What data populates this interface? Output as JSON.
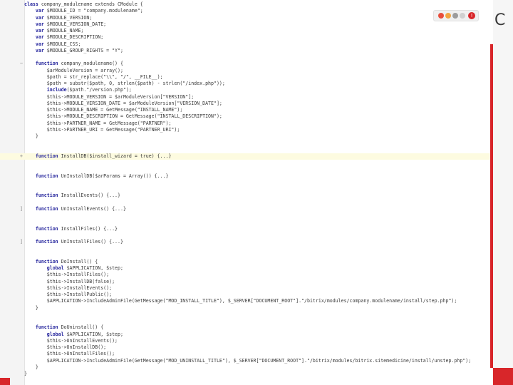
{
  "editor": {
    "lines": [
      {
        "fold": "",
        "text": "class company_modulename extends CModule {",
        "hl": false
      },
      {
        "fold": "",
        "text": "    var $MODULE_ID = \"company.modulename\";",
        "hl": false
      },
      {
        "fold": "",
        "text": "    var $MODULE_VERSION;",
        "hl": false
      },
      {
        "fold": "",
        "text": "    var $MODULE_VERSION_DATE;",
        "hl": false
      },
      {
        "fold": "",
        "text": "    var $MODULE_NAME;",
        "hl": false
      },
      {
        "fold": "",
        "text": "    var $MODULE_DESCRIPTION;",
        "hl": false
      },
      {
        "fold": "",
        "text": "    var $MODULE_CSS;",
        "hl": false
      },
      {
        "fold": "",
        "text": "    var $MODULE_GROUP_RIGHTS = \"Y\";",
        "hl": false
      },
      {
        "fold": "",
        "text": "",
        "hl": false
      },
      {
        "fold": "−",
        "text": "    function company_modulename() {",
        "hl": false
      },
      {
        "fold": "",
        "text": "        $arModuleVersion = array();",
        "hl": false
      },
      {
        "fold": "",
        "text": "        $path = str_replace(\"\\\\\", \"/\", __FILE__);",
        "hl": false
      },
      {
        "fold": "",
        "text": "        $path = substr($path, 0, strlen($path) - strlen(\"/index.php\"));",
        "hl": false
      },
      {
        "fold": "",
        "text": "        include($path.\"/version.php\");",
        "hl": false
      },
      {
        "fold": "",
        "text": "        $this->MODULE_VERSION = $arModuleVersion[\"VERSION\"];",
        "hl": false
      },
      {
        "fold": "",
        "text": "        $this->MODULE_VERSION_DATE = $arModuleVersion[\"VERSION_DATE\"];",
        "hl": false
      },
      {
        "fold": "",
        "text": "        $this->MODULE_NAME = GetMessage(\"INSTALL_NAME\");",
        "hl": false
      },
      {
        "fold": "",
        "text": "        $this->MODULE_DESCRIPTION = GetMessage(\"INSTALL_DESCRIPTION\");",
        "hl": false
      },
      {
        "fold": "",
        "text": "        $this->PARTNER_NAME = GetMessage(\"PARTNER\");",
        "hl": false
      },
      {
        "fold": "",
        "text": "        $this->PARTNER_URI = GetMessage(\"PARTNER_URI\");",
        "hl": false
      },
      {
        "fold": "",
        "text": "    }",
        "hl": false
      },
      {
        "fold": "",
        "text": "",
        "hl": false
      },
      {
        "fold": "",
        "text": "",
        "hl": false
      },
      {
        "fold": "+",
        "text": "    function InstallDB($install_wizard = true) {...}",
        "hl": true
      },
      {
        "fold": "",
        "text": "",
        "hl": false
      },
      {
        "fold": "",
        "text": "",
        "hl": false
      },
      {
        "fold": "",
        "text": "    function UnInstallDB($arParams = Array()) {...}",
        "hl": false
      },
      {
        "fold": "",
        "text": "",
        "hl": false
      },
      {
        "fold": "",
        "text": "",
        "hl": false
      },
      {
        "fold": "",
        "text": "    function InstallEvents() {...}",
        "hl": false
      },
      {
        "fold": "",
        "text": "",
        "hl": false
      },
      {
        "fold": "]",
        "text": "    function UnInstallEvents() {...}",
        "hl": false
      },
      {
        "fold": "",
        "text": "",
        "hl": false
      },
      {
        "fold": "",
        "text": "",
        "hl": false
      },
      {
        "fold": "",
        "text": "    function InstallFiles() {...}",
        "hl": false
      },
      {
        "fold": "",
        "text": "",
        "hl": false
      },
      {
        "fold": "]",
        "text": "    function UnInstallFiles() {...}",
        "hl": false
      },
      {
        "fold": "",
        "text": "",
        "hl": false
      },
      {
        "fold": "",
        "text": "",
        "hl": false
      },
      {
        "fold": "",
        "text": "    function DoInstall() {",
        "hl": false
      },
      {
        "fold": "",
        "text": "        global $APPLICATION, $step;",
        "hl": false
      },
      {
        "fold": "",
        "text": "        $this->InstallFiles();",
        "hl": false
      },
      {
        "fold": "",
        "text": "        $this->InstallDB(false);",
        "hl": false
      },
      {
        "fold": "",
        "text": "        $this->InstallEvents();",
        "hl": false
      },
      {
        "fold": "",
        "text": "        $this->InstallPublic();",
        "hl": false
      },
      {
        "fold": "",
        "text": "        $APPLICATION->IncludeAdminFile(GetMessage(\"MOD_INSTALL_TITLE\"), $_SERVER[\"DOCUMENT_ROOT\"].\"/bitrix/modules/company.modulename/install/step.php\");",
        "hl": false
      },
      {
        "fold": "",
        "text": "    }",
        "hl": false
      },
      {
        "fold": "",
        "text": "",
        "hl": false
      },
      {
        "fold": "",
        "text": "",
        "hl": false
      },
      {
        "fold": "",
        "text": "    function DoUninstall() {",
        "hl": false
      },
      {
        "fold": "",
        "text": "        global $APPLICATION, $step;",
        "hl": false
      },
      {
        "fold": "",
        "text": "        $this->UnInstallEvents();",
        "hl": false
      },
      {
        "fold": "",
        "text": "        $this->UnInstallDB();",
        "hl": false
      },
      {
        "fold": "",
        "text": "        $this->UnInstallFiles();",
        "hl": false
      },
      {
        "fold": "",
        "text": "        $APPLICATION->IncludeAdminFile(GetMessage(\"MOD_UNINSTALL_TITLE\"), $_SERVER[\"DOCUMENT_ROOT\"].\"/bitrix/modules/bitrix.sitemedicine/install/unstep.php\");",
        "hl": false
      },
      {
        "fold": "",
        "text": "    }",
        "hl": false
      },
      {
        "fold": "",
        "text": "}",
        "hl": false
      }
    ]
  },
  "side": {
    "letter": "C",
    "badge": "!"
  },
  "colors": {
    "accent_red": "#d8262a",
    "highlight_line": "#fdfbe0",
    "keyword": "#1f1f9a",
    "string": "#0a7a0a"
  },
  "icons": [
    "close-icon",
    "minimize-icon",
    "tab-icon",
    "bookmark-icon",
    "alert-icon"
  ]
}
